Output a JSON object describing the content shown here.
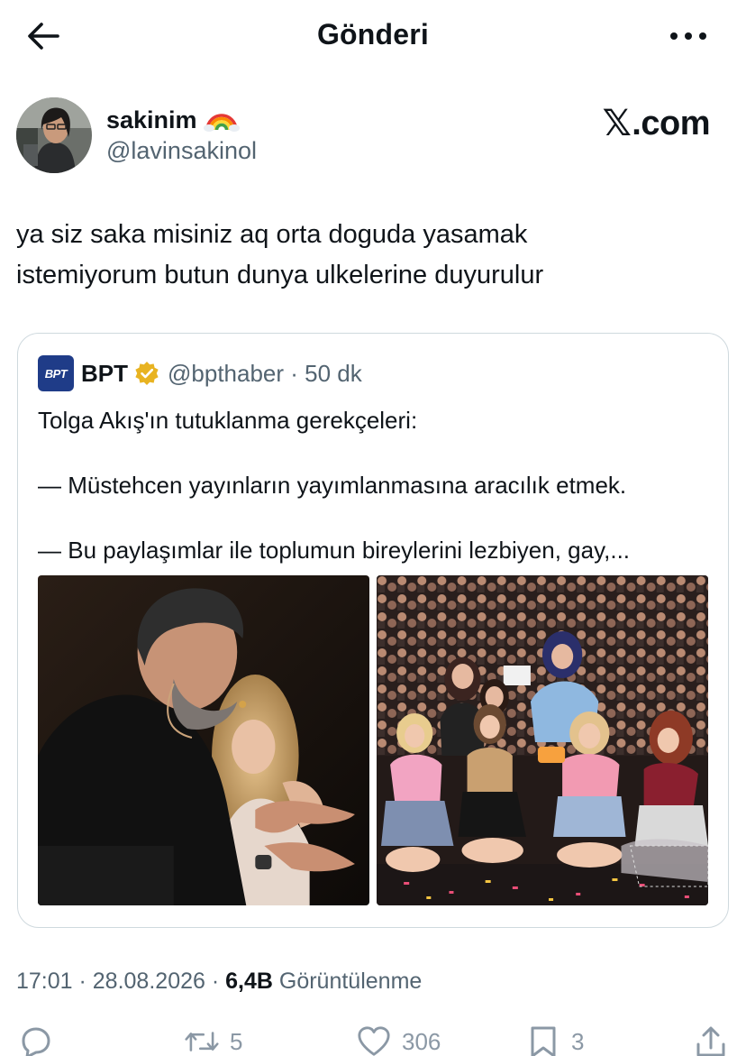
{
  "header": {
    "title": "Gönderi",
    "back_icon": "arrow-left-icon",
    "more_icon": "more-horizontal-icon"
  },
  "author": {
    "display_name": "sakinim",
    "badge_icon": "rainbow-emoji-icon",
    "handle": "@lavinsakinol",
    "brand_x": "𝕏",
    "brand_rest": ".com"
  },
  "tweet": {
    "line1": "ya siz saka misiniz aq orta doguda yasamak",
    "line2": "istemiyorum butun dunya ulkelerine duyurulur"
  },
  "quote": {
    "logo_text": "BPT",
    "name": "BPT",
    "verified_icon": "gold-verified-badge-icon",
    "handle_time": "@bpthaber · 50 dk",
    "text_title": "Tolga Akış'ın tutuklanma gerekçeleri:",
    "text_item1": "— Müstehcen yayınların yayımlanmasına aracılık etmek.",
    "text_item2": "— Bu paylaşımlar ile toplumun bireylerini lezbiyen, gay,..."
  },
  "meta": {
    "time_date": "17:01 · 28.08.2026 · ",
    "views_count": "6,4B",
    "views_label": " Görüntülenme"
  },
  "actions": {
    "reply_count": "",
    "retweet_count": "5",
    "like_count": "306",
    "bookmark_count": "3"
  },
  "colors": {
    "text_primary": "#0f1419",
    "text_secondary": "#536471",
    "border": "#cfd9de",
    "verified_gold": "#e8b321",
    "bpt_blue": "#1f3c88"
  }
}
